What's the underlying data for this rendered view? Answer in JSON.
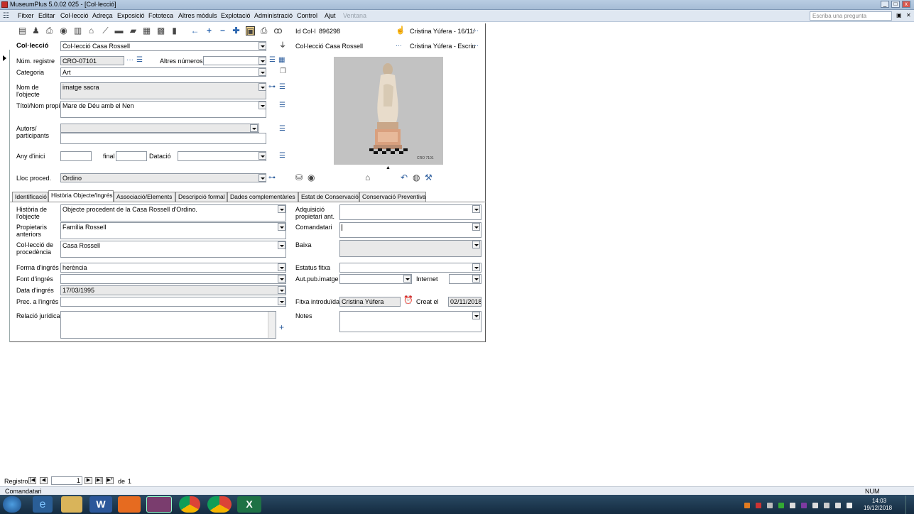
{
  "window": {
    "title": "MuseumPlus 5.0.02 025 - [Col·lecció]"
  },
  "menu": {
    "items": [
      "Fitxer",
      "Editar",
      "Col·lecció",
      "Adreça",
      "Exposició",
      "Fototeca",
      "Altres mòduls",
      "Explotació",
      "Administració",
      "Control",
      "Ajut"
    ],
    "disabled": "Ventana",
    "ask_placeholder": "Escriba una pregunta"
  },
  "header": {
    "idcol_label": "Id Col·l",
    "idcol_value": "896298",
    "user1": "Cristina Yúfera - 16/11/",
    "coll_label": "Col·lecció",
    "coll_value": "Col·lecció Casa Rossell",
    "coll_right": "Col·lecció Casa Rossell",
    "user2": "Cristina Yúfera - Escriu"
  },
  "fields": {
    "num_registre_label": "Núm. registre",
    "num_registre": "CRO-07101",
    "altres_label": "Altres números",
    "altres": "",
    "categoria_label": "Categoria",
    "categoria": "Art",
    "nom_label": "Nom de l'objecte",
    "nom": "imatge sacra",
    "titol_label": "Títol/Nom propi",
    "titol": "Mare de Déu amb el Nen",
    "autors_label": "Autors/ participants",
    "any_label": "Any d'inici",
    "final_label": "final",
    "datacio_label": "Datació",
    "lloc_label": "Lloc proced.",
    "lloc": "Ordino"
  },
  "tabs": [
    "Identificació",
    "Història Objecte/Ingrés",
    "Associació/Elements",
    "Descripció formal",
    "Dades complementàries",
    "Estat de Conservació",
    "Conservació Preventiva"
  ],
  "history": {
    "historia_label": "Història de l'objecte",
    "historia": "Objecte procedent de la Casa Rossell d'Ordino.",
    "propietaris_label": "Propietaris anteriors",
    "propietaris": "Família Rossell",
    "colproc_label": "Col·lecció de procedència",
    "colproc": "Casa Rossell",
    "forma_label": "Forma d'ingrés",
    "forma": "herència",
    "font_label": "Font d'ingrés",
    "font": "",
    "data_label": "Data d'ingrés",
    "data": "17/03/1995",
    "prec_label": "Prec. a l'ingrés",
    "prec": "",
    "relacio_label": "Relació jurídica",
    "adq_label": "Adquisició propietari ant.",
    "comandatari_label": "Comandatari",
    "baixa_label": "Baixa",
    "estatus_label": "Estatus fitxa",
    "autpub_label": "Aut.pub.imatge",
    "internet_label": "Internet",
    "fitxa_label": "Fitxa introduïda",
    "fitxa": "Cristina Yúfera",
    "creat_label": "Creat el",
    "creat": "02/11/2018",
    "notes_label": "Notes"
  },
  "photo": {
    "caption": "CRO 7101"
  },
  "record_nav": {
    "label": "Registro:",
    "current": "1",
    "of": "de",
    "total": "1"
  },
  "statusbar": {
    "text": "Comandatari",
    "num": "NUM"
  },
  "clock": {
    "time": "14:03",
    "date": "19/12/2018"
  }
}
